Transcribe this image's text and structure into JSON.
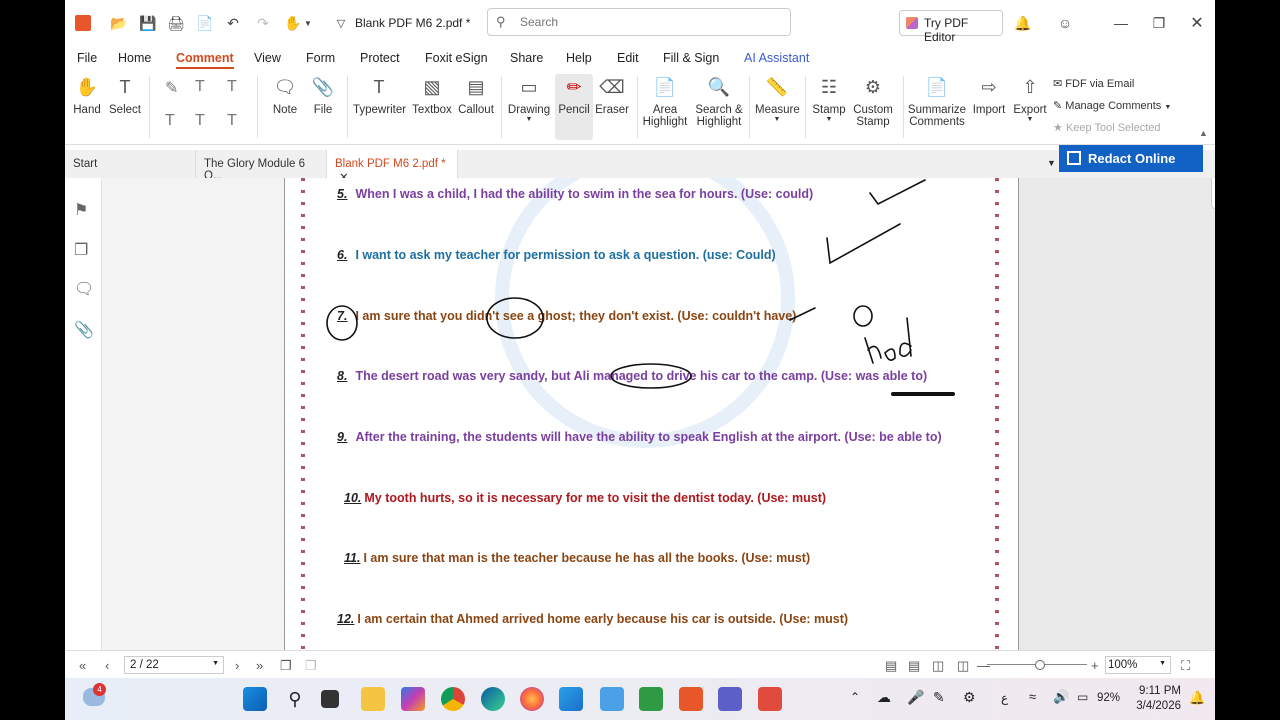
{
  "titlebar": {
    "document_title": "Blank PDF M6 2.pdf *",
    "search_placeholder": "Search",
    "try_editor_label": "Try PDF Editor"
  },
  "menu": {
    "items": [
      "File",
      "Home",
      "Comment",
      "View",
      "Form",
      "Protect",
      "Foxit eSign",
      "Share",
      "Help",
      "Edit",
      "Fill & Sign",
      "AI Assistant"
    ],
    "active": "Comment"
  },
  "ribbon": {
    "hand": "Hand",
    "select": "Select",
    "note": "Note",
    "file": "File",
    "typewriter": "Typewriter",
    "textbox": "Textbox",
    "callout": "Callout",
    "drawing": "Drawing",
    "pencil": "Pencil",
    "eraser": "Eraser",
    "area_highlight_1": "Area",
    "area_highlight_2": "Highlight",
    "search_highlight_1": "Search &",
    "search_highlight_2": "Highlight",
    "measure": "Measure",
    "stamp": "Stamp",
    "custom_stamp_1": "Custom",
    "custom_stamp_2": "Stamp",
    "summarize_1": "Summarize",
    "summarize_2": "Comments",
    "import": "Import",
    "export": "Export",
    "fdf_email": "FDF via Email",
    "manage_comments": "Manage Comments",
    "keep_tool": "Keep Tool Selected"
  },
  "tabs": {
    "items": [
      "Start",
      "The Glory Module 6 Q...",
      "Blank PDF M6 2.pdf *"
    ],
    "redact_online": "Redact Online"
  },
  "document": {
    "questions": [
      {
        "num": "5.",
        "text": "When I was a child, I had the ability to swim in the sea for hours. (Use: could)"
      },
      {
        "num": "6.",
        "text": "I want to ask my teacher for permission to ask a question. (use: Could)"
      },
      {
        "num": "7.",
        "text": "I am sure that you didn't see a ghost; they don't exist. (Use: couldn't have)"
      },
      {
        "num": "8.",
        "text": "The desert road was very sandy, but Ali managed to drive his car to the camp. (Use: was able to)"
      },
      {
        "num": "9.",
        "text": "After the training, the students will have the ability to speak English at the airport. (Use: be able to)"
      },
      {
        "num": "10.",
        "text": "My tooth hurts, so it is necessary for me to visit the dentist today. (Use: must)"
      },
      {
        "num": "11.",
        "text": "I am sure that man is the teacher because he has all the books. (Use: must)"
      },
      {
        "num": "12.",
        "text": "I am certain that Ahmed arrived home early because his car is outside. (Use: must)"
      }
    ],
    "handwriting": "had"
  },
  "bottombar": {
    "page_indicator": "2 / 22",
    "zoom": "100%"
  },
  "taskbar": {
    "weather_badge": "4",
    "battery": "92%",
    "time": "9:11 PM",
    "date": "3/4/2026",
    "lang": "ع"
  },
  "colors": {
    "accent": "#d44a1e",
    "redact_blue": "#1162c4",
    "q_purple": "#7a3fa0",
    "q_blue": "#1d6fa0",
    "q_brown": "#8b4513",
    "q_red": "#b0181e"
  }
}
